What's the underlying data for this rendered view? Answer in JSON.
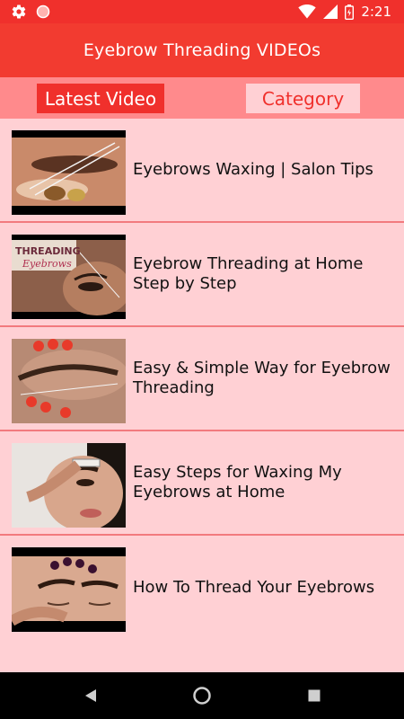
{
  "status_bar": {
    "time": "2:21",
    "icons": [
      "settings-icon",
      "circle-dot-icon",
      "wifi-icon",
      "signal-icon",
      "battery-icon"
    ]
  },
  "app_bar": {
    "title": "Eyebrow Threading VIDEOs"
  },
  "tabs": [
    {
      "label": "Latest Video",
      "active": true
    },
    {
      "label": "Category",
      "active": false
    }
  ],
  "videos": [
    {
      "title": "Eyebrows Waxing | Salon Tips"
    },
    {
      "title": "Eyebrow Threading at Home Step by Step",
      "thumb_caption": [
        "THREADING",
        "Eyebrows"
      ]
    },
    {
      "title": "Easy & Simple Way for Eyebrow Threading"
    },
    {
      "title": "Easy Steps for Waxing My Eyebrows at Home"
    },
    {
      "title": "How To Thread Your Eyebrows"
    }
  ],
  "nav_bar": {
    "buttons": [
      "back-icon",
      "home-icon",
      "recents-icon"
    ]
  },
  "colors": {
    "primary": "#f0302c",
    "tab_bar": "#ff8a8c",
    "background": "#ffd0d4",
    "divider": "#f27a7e"
  }
}
